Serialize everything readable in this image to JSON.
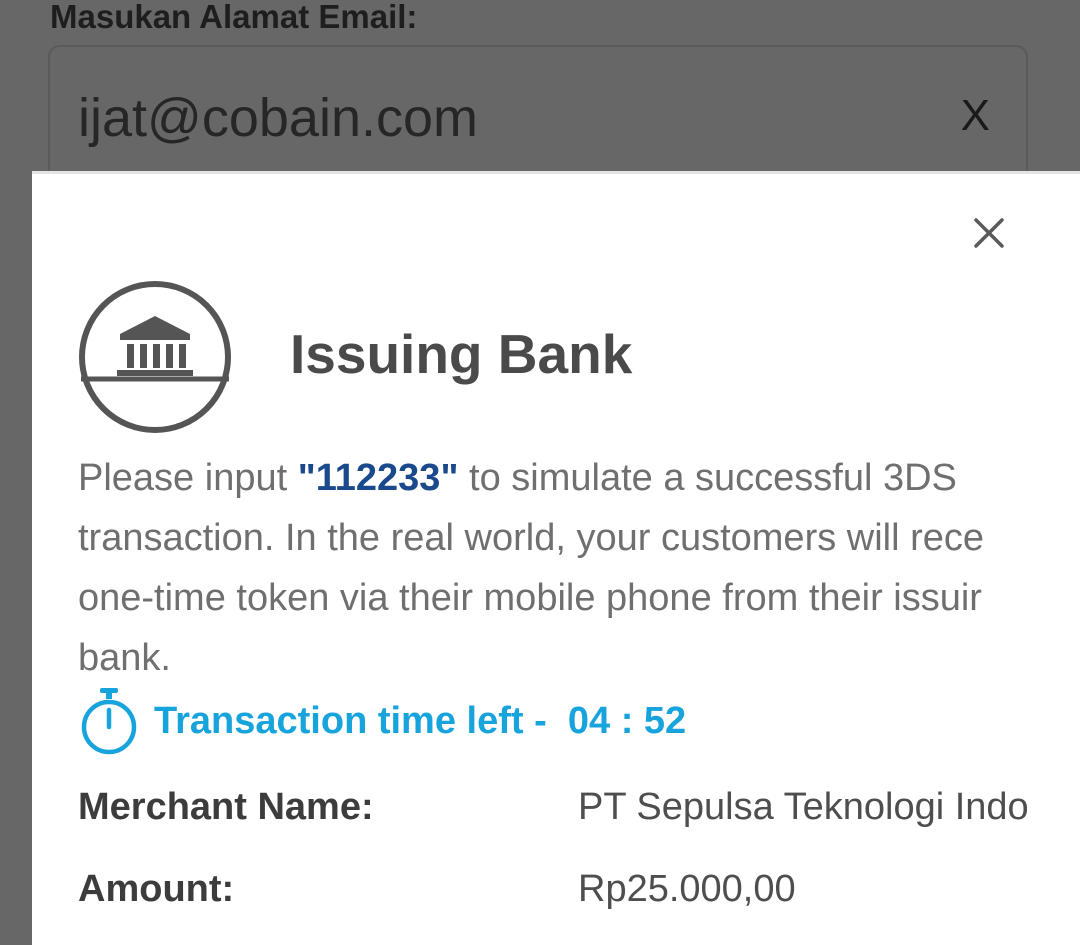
{
  "background": {
    "email_label": "Masukan Alamat Email:",
    "email_value": "ijat@cobain.com",
    "clear_label": "X"
  },
  "modal": {
    "title": "Issuing Bank",
    "close_icon": "close-icon",
    "logo_icon": "bank-icon",
    "instructions": {
      "line1_prefix": "Please input ",
      "otp_code": "\"112233\"",
      "line1_suffix": " to simulate a successful 3DS",
      "line2": "transaction. In the real world, your customers will rece",
      "line3": "one-time token via their mobile phone from their issuir",
      "line4": "bank."
    },
    "timer": {
      "icon": "stopwatch-icon",
      "label": "Transaction time left -  ",
      "time": "04 : 52"
    },
    "details": [
      {
        "label": "Merchant Name:",
        "value": "PT Sepulsa Teknologi Indo"
      },
      {
        "label": "Amount:",
        "value": "Rp25.000,00"
      }
    ]
  },
  "colors": {
    "overlay": "#676767",
    "title": "#4a4a4a",
    "otp_code": "#1a4a8c",
    "timer": "#17a3dc",
    "body_text": "#6f6f6f"
  }
}
